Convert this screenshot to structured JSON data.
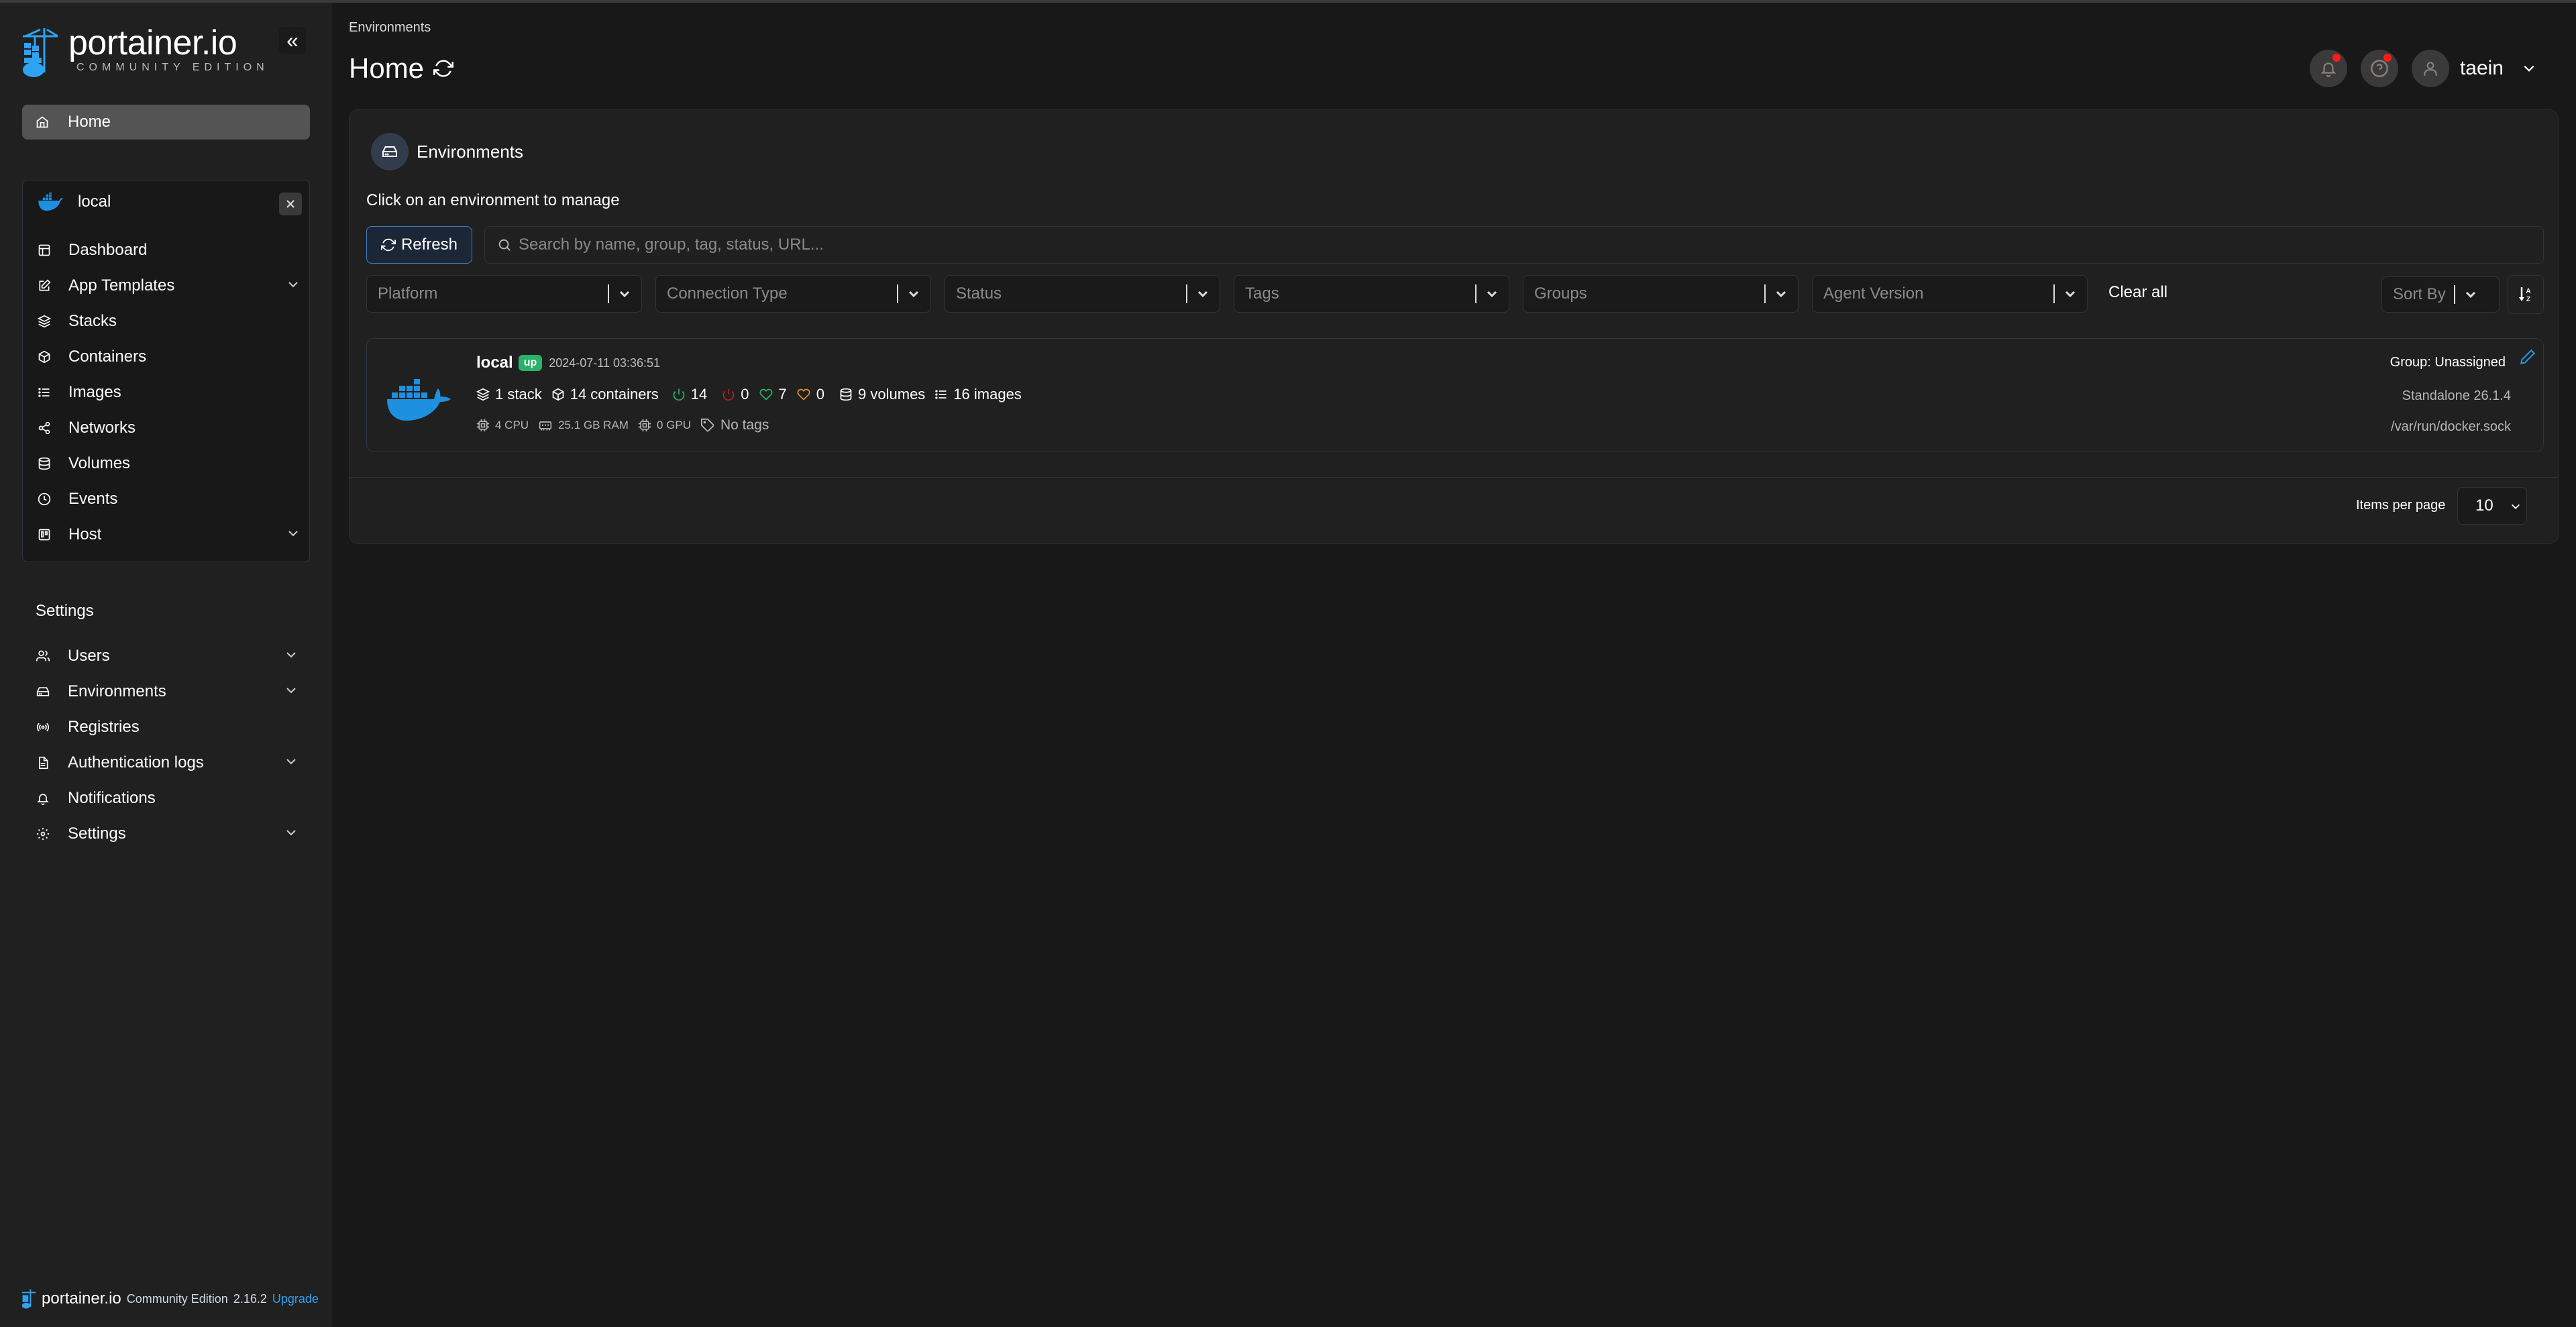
{
  "brand": {
    "name": "portainer.io",
    "edition": "COMMUNITY EDITION",
    "accent": "#2ea3f2"
  },
  "sidebar": {
    "collapse_icon": "double-chevron-left",
    "home": {
      "label": "Home",
      "icon": "home-icon"
    },
    "environment": {
      "name": "local",
      "icon": "docker-icon",
      "items": [
        {
          "label": "Dashboard",
          "icon": "dashboard-icon",
          "expandable": false
        },
        {
          "label": "App Templates",
          "icon": "edit-icon",
          "expandable": true
        },
        {
          "label": "Stacks",
          "icon": "layers-icon",
          "expandable": false
        },
        {
          "label": "Containers",
          "icon": "box-icon",
          "expandable": false
        },
        {
          "label": "Images",
          "icon": "list-icon",
          "expandable": false
        },
        {
          "label": "Networks",
          "icon": "share-icon",
          "expandable": false
        },
        {
          "label": "Volumes",
          "icon": "database-icon",
          "expandable": false
        },
        {
          "label": "Events",
          "icon": "clock-icon",
          "expandable": false
        },
        {
          "label": "Host",
          "icon": "trello-icon",
          "expandable": true
        }
      ]
    },
    "settings_title": "Settings",
    "settings_items": [
      {
        "label": "Users",
        "icon": "users-icon",
        "expandable": true
      },
      {
        "label": "Environments",
        "icon": "hard-drive-icon",
        "expandable": true
      },
      {
        "label": "Registries",
        "icon": "radio-icon",
        "expandable": false
      },
      {
        "label": "Authentication logs",
        "icon": "file-text-icon",
        "expandable": true
      },
      {
        "label": "Notifications",
        "icon": "bell-icon",
        "expandable": false
      },
      {
        "label": "Settings",
        "icon": "gear-icon",
        "expandable": true
      }
    ],
    "footer": {
      "brand": "portainer.io",
      "edition": "Community Edition",
      "version": "2.16.2",
      "upgrade": "Upgrade"
    }
  },
  "header": {
    "breadcrumb": "Environments",
    "title": "Home",
    "user": "taein"
  },
  "environments": {
    "title": "Environments",
    "hint": "Click on an environment to manage",
    "refresh_label": "Refresh",
    "search_placeholder": "Search by name, group, tag, status, URL...",
    "filters": [
      "Platform",
      "Connection Type",
      "Status",
      "Tags",
      "Groups",
      "Agent Version"
    ],
    "clear_all": "Clear all",
    "sort_by_placeholder": "Sort By",
    "items": [
      {
        "name": "local",
        "status": "up",
        "timestamp": "2024-07-11 03:36:51",
        "stacks": "1 stack",
        "containers": "14 containers",
        "running": "14",
        "stopped": "0",
        "healthy": "7",
        "unhealthy": "0",
        "volumes": "9 volumes",
        "images": "16 images",
        "cpu": "4 CPU",
        "ram": "25.1 GB RAM",
        "gpu": "0 GPU",
        "tags": "No tags",
        "group": "Group: Unassigned",
        "version": "Standalone 26.1.4",
        "url": "/var/run/docker.sock"
      }
    ],
    "items_per_page_label": "Items per page",
    "items_per_page": "10"
  },
  "colors": {
    "running": "#2ab26a",
    "stopped": "#b3261e",
    "healthy": "#2ab26a",
    "unhealthy": "#e0912b",
    "badge_up": "#2ab26a",
    "notification_dot": "#ff1a1a"
  }
}
